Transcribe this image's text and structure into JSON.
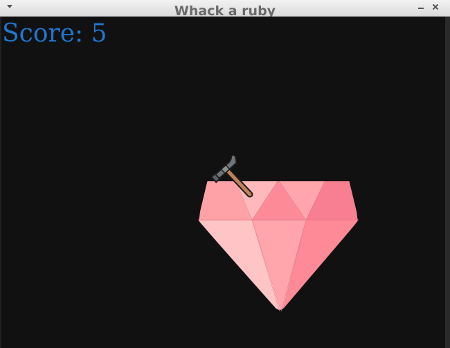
{
  "window": {
    "title": "Whack a ruby"
  },
  "game": {
    "score_text": "Score: 5",
    "score_value": 5
  },
  "icons": {
    "menu": "chevron-down-icon",
    "minimize": "minimize-icon",
    "close": "close-icon",
    "target": "ruby-gem-icon",
    "cursor": "hammer-icon"
  },
  "colors": {
    "background": "#111111",
    "score": "#1f77d0",
    "ruby_light": "#ffc4c6",
    "ruby_mid": "#ffa5ab",
    "ruby_dark": "#fd8a96",
    "ruby_deep": "#f87f92",
    "hammer_head": "#6f7478",
    "hammer_handle": "#c08358"
  }
}
